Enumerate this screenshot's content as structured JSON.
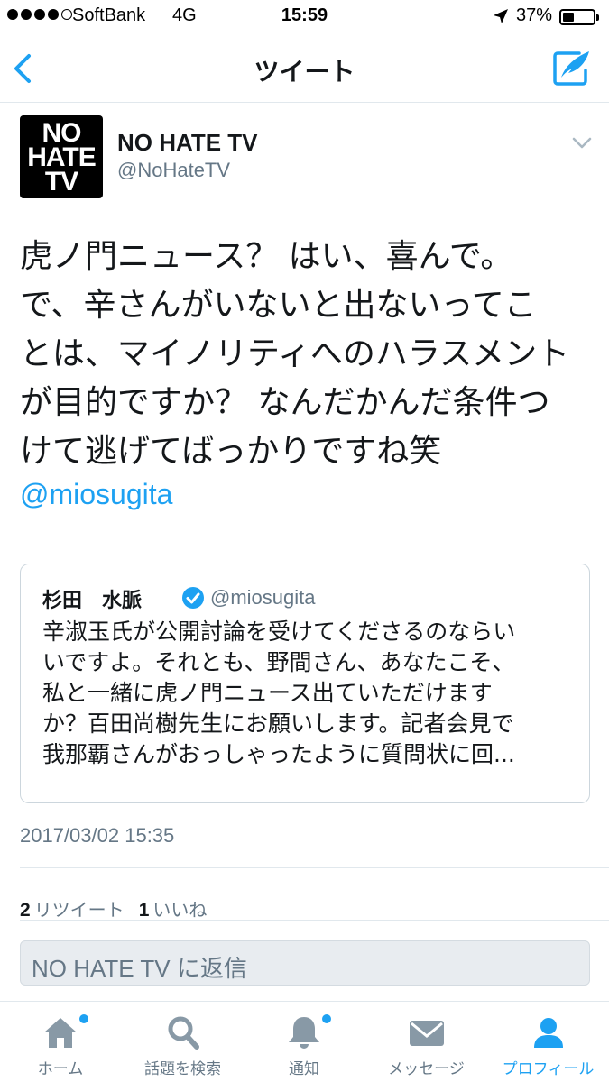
{
  "status_bar": {
    "carrier": "SoftBank",
    "network": "4G",
    "time": "15:59",
    "battery_percent": "37%",
    "battery_level": 0.37,
    "signal_bars_filled": 4
  },
  "nav": {
    "title": "ツイート"
  },
  "tweet": {
    "display_name": "NO HATE TV",
    "handle": "@NoHateTV",
    "avatar_text": [
      "NO",
      "HATE",
      "TV"
    ],
    "text": "虎ノ門ニュース？ はい、喜んで。\nで、辛さんがいないと出ないってこ\nとは、マイノリティへのハラスメント\nが目的ですか？ なんだかんだ条件つ\nけて逃げてばっかりですね笑",
    "mention": "@miosugita",
    "timestamp": "2017/03/02 15:35",
    "retweet_count": "2",
    "retweet_label": "リツイート",
    "like_count": "1",
    "like_label": "いいね"
  },
  "quoted_tweet": {
    "display_name": "杉田　水脈",
    "handle": "@miosugita",
    "text": "辛淑玉氏が公開討論を受けてくださるのならい\nいですよ。それとも、野間さん、あなたこそ、\n私と一緒に虎ノ門ニュース出ていただけます\nか？百田尚樹先生にお願いします。記者会見で\n我那覇さんがおっしゃったように質問状に回..."
  },
  "reply": {
    "placeholder": "NO HATE TV に返信"
  },
  "tab_bar": {
    "tabs": [
      {
        "label": "ホーム",
        "icon": "home-icon",
        "has_dot": true,
        "active": false
      },
      {
        "label": "話題を検索",
        "icon": "search-icon",
        "has_dot": false,
        "active": false
      },
      {
        "label": "通知",
        "icon": "bell-icon",
        "has_dot": true,
        "active": false
      },
      {
        "label": "メッセージ",
        "icon": "envelope-icon",
        "has_dot": false,
        "active": false
      },
      {
        "label": "プロフィール",
        "icon": "person-icon",
        "has_dot": false,
        "active": true
      }
    ]
  },
  "colors": {
    "accent": "#1da1f2",
    "text": "#14171a",
    "secondary_text": "#657786",
    "icon_gray": "#8899a6"
  }
}
